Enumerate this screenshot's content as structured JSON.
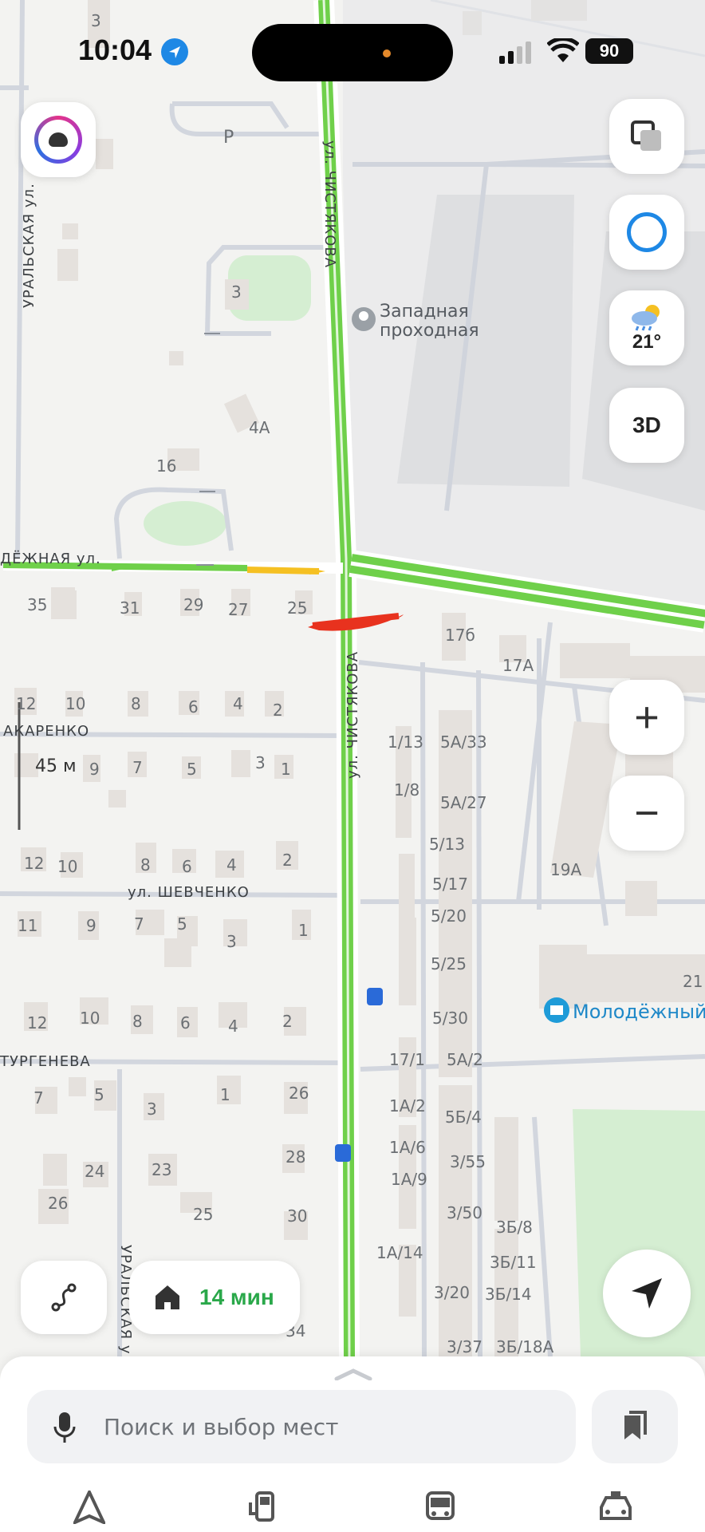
{
  "status_bar": {
    "time": "10:04",
    "battery": "90"
  },
  "weather": {
    "temperature": "21°"
  },
  "map": {
    "streets": {
      "chistyakova_top": "ул. ЧИСТЯКОВА",
      "chistyakova_mid": "ул. ЧИСТЯКОВА",
      "uralskaya_top": "УРАЛЬСКАЯ ул.",
      "uralskaya_bottom": "УРАЛЬСКАЯ у",
      "molodezhnaya": "ДЁЖНАЯ ул.",
      "makarenko": "АКАРЕНКО",
      "shevchenko": "ул. ШЕВЧЕНКО",
      "turgeneva": "ТУРГЕНЕВА"
    },
    "pois": {
      "zapadnaya_line1": "Западная",
      "zapadnaya_line2": "проходная",
      "molodezhny": "Молодёжный"
    },
    "parking": "P",
    "scale": "45 м",
    "house_numbers": {
      "h3a": "3",
      "h3b": "3",
      "h4a": "4А",
      "h16": "16",
      "h35": "35",
      "h31": "31",
      "h29": "29",
      "h27": "27",
      "h25": "25",
      "h17b": "17б",
      "h17a": "17А",
      "r1_12": "12",
      "r1_10": "10",
      "r1_8": "8",
      "r1_6": "6",
      "r1_4": "4",
      "r1_2": "2",
      "r2_9": "9",
      "r2_7": "7",
      "r2_5": "5",
      "r2_3": "3",
      "r2_1": "1",
      "r3_12": "12",
      "r3_10": "10",
      "r3_8": "8",
      "r3_6": "6",
      "r3_4": "4",
      "r3_2": "2",
      "r4_11": "11",
      "r4_9": "9",
      "r4_7": "7",
      "r4_5": "5",
      "r4_3": "3",
      "r4_1": "1",
      "r5_12": "12",
      "r5_10": "10",
      "r5_8": "8",
      "r5_6": "6",
      "r5_4": "4",
      "r5_2": "2",
      "r6_7": "7",
      "r6_5": "5",
      "r6_3": "3",
      "r6_1": "1",
      "r6_26": "26",
      "r7_24": "24",
      "r7_23": "23",
      "r7_28": "28",
      "r7_26": "26",
      "r7_25": "25",
      "r7_30": "30",
      "r7_34": "34",
      "e_1_13": "1/13",
      "e_5a33": "5А/33",
      "e_1_8": "1/8",
      "e_5a27": "5А/27",
      "e_5_13": "5/13",
      "e_5_17": "5/17",
      "e_5_20": "5/20",
      "e_5_25": "5/25",
      "e_5_30": "5/30",
      "e_17_1": "17/1",
      "e_5a2": "5А/2",
      "e_1a2": "1А/2",
      "e_5b4": "5Б/4",
      "e_1a6": "1А/6",
      "e_3_55": "3/55",
      "e_1a9": "1А/9",
      "e_3_50": "3/50",
      "e_3b8": "3Б/8",
      "e_1a14": "1А/14",
      "e_3b11": "3Б/11",
      "e_3_20": "3/20",
      "e_3b14": "3Б/14",
      "e_3_37": "3/37",
      "e_3b18a": "3Б/18А",
      "e_19a": "19А",
      "e_21": "21"
    }
  },
  "controls": {
    "three_d": "3D",
    "zoom_in": "+",
    "zoom_out": "−"
  },
  "route": {
    "eta": "14 мин"
  },
  "search": {
    "placeholder": "Поиск и выбор мест"
  },
  "colors": {
    "traffic_green": "#6fd04a",
    "traffic_yellow": "#f5c022",
    "traffic_red": "#e8321e",
    "accent_blue": "#1e88e5",
    "eta_green": "#2aa84a"
  },
  "icons": [
    "location-arrow-icon",
    "camera-profile-icon",
    "layers-icon",
    "alice-icon",
    "weather-icon",
    "route-curve-icon",
    "home-icon",
    "navigate-icon",
    "mic-icon",
    "bookmarks-icon",
    "navigator-tab-icon",
    "fuel-tab-icon",
    "transport-tab-icon",
    "taxi-tab-icon",
    "store-icon",
    "bus-stop-icon",
    "poi-pin-icon"
  ]
}
